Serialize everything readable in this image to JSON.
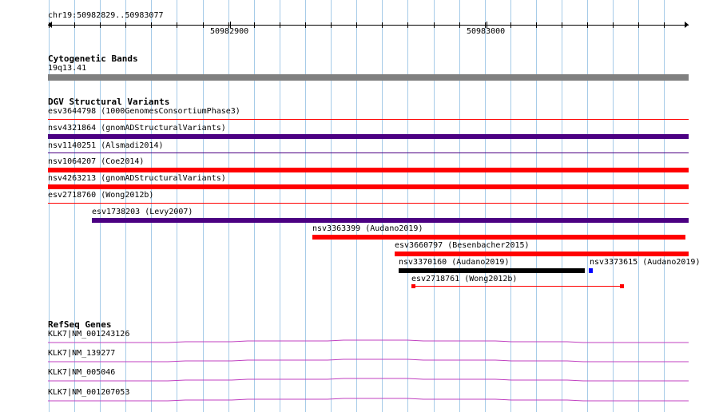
{
  "location": "chr19:50982829..50983077",
  "ruler": {
    "labels": [
      "50982900",
      "50983000"
    ]
  },
  "cytoband": {
    "title": "Cytogenetic Bands",
    "band": "19q13.41"
  },
  "dgv": {
    "title": "DGV Structural Variants",
    "variants": [
      {
        "label": "esv3644798 (1000GenomesConsortiumPhase3)"
      },
      {
        "label": "nsv4321864 (gnomADStructuralVariants)"
      },
      {
        "label": "nsv1140251 (Alsmadi2014)"
      },
      {
        "label": "nsv1064207 (Coe2014)"
      },
      {
        "label": "nsv4263213 (gnomADStructuralVariants)"
      },
      {
        "label": "esv2718760 (Wong2012b)"
      },
      {
        "label": "esv1738203 (Levy2007)"
      },
      {
        "label": "nsv3363399 (Audano2019)"
      },
      {
        "label": "esv3660797 (Besenbacher2015)"
      },
      {
        "label": "nsv3370160 (Audano2019)"
      },
      {
        "label": "nsv3373615 (Audano2019)"
      },
      {
        "label": "esv2718761 (Wong2012b)"
      }
    ]
  },
  "refseq": {
    "title": "RefSeq Genes",
    "genes": [
      {
        "label": "KLK7|NM_001243126"
      },
      {
        "label": "KLK7|NM_139277"
      },
      {
        "label": "KLK7|NM_005046"
      },
      {
        "label": "KLK7|NM_001207053"
      }
    ]
  },
  "colors": {
    "loss": "#ff0000",
    "gain": "#4b0082",
    "complex": "#000000",
    "insertion": "#0000ff",
    "gene": "#c040c0",
    "grid": "#a6cbe8",
    "band": "#808080"
  }
}
